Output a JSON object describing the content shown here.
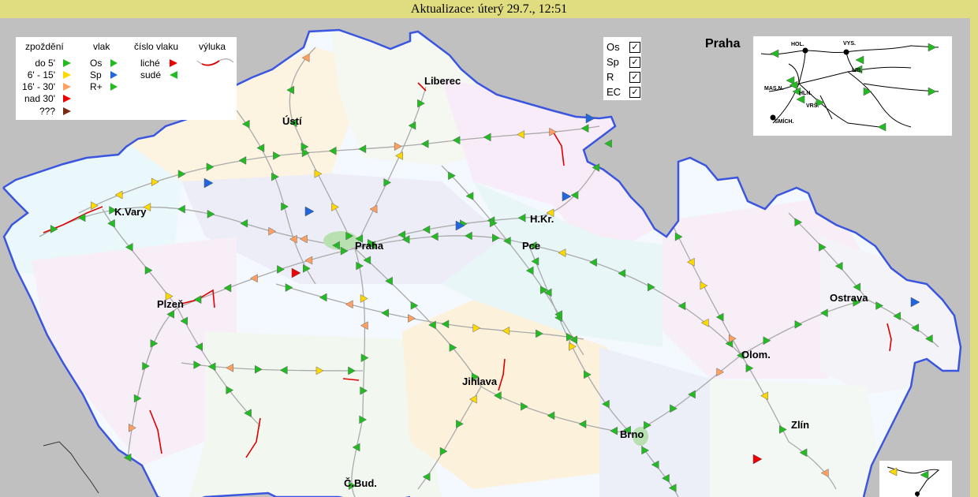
{
  "header": {
    "update_text": "Aktualizace: úterý 29.7., 12:51"
  },
  "legend": {
    "col_delay_title": "zpoždění",
    "col_train_title": "vlak",
    "col_number_title": "číslo vlaku",
    "col_closure_title": "výluka",
    "delay_items": [
      {
        "label": "do 5'",
        "color": "#22bb22"
      },
      {
        "label": "6' - 15'",
        "color": "#ffd800"
      },
      {
        "label": "16' - 30'",
        "color": "#ffa060"
      },
      {
        "label": "nad 30'",
        "color": "#ee0000"
      },
      {
        "label": "???",
        "color": "#7a2a10"
      }
    ],
    "train_items": [
      {
        "label": "Os",
        "color": "#22bb22"
      },
      {
        "label": "Sp",
        "color": "#2266dd"
      },
      {
        "label": "R+",
        "color": "#22bb22"
      }
    ],
    "number_items": [
      {
        "label": "liché"
      },
      {
        "label": "sudé"
      }
    ]
  },
  "filters": [
    {
      "label": "Os",
      "checked": true
    },
    {
      "label": "Sp",
      "checked": true
    },
    {
      "label": "R",
      "checked": true
    },
    {
      "label": "EC",
      "checked": true
    }
  ],
  "praha_inset": {
    "title": "Praha",
    "stations": [
      "HOL.",
      "VYS.",
      "LIB.",
      "MAS.N.",
      "HLN.",
      "VRŠ.",
      "SMÍCH."
    ]
  },
  "cities": [
    {
      "name": "Liberec"
    },
    {
      "name": "Ústí"
    },
    {
      "name": "K.Vary"
    },
    {
      "name": "Praha"
    },
    {
      "name": "H.Kr."
    },
    {
      "name": "Pce"
    },
    {
      "name": "Plzeň"
    },
    {
      "name": "Ostrava"
    },
    {
      "name": "Olom."
    },
    {
      "name": "Jihlava"
    },
    {
      "name": "Brno"
    },
    {
      "name": "Zlín"
    },
    {
      "name": "Č.Bud."
    }
  ],
  "colors": {
    "top_bar": "#e0dc80",
    "outside": "#c0c0c0",
    "border": "#3a55e0",
    "rail": "#aaaaaa",
    "closure": "#dd0000"
  }
}
